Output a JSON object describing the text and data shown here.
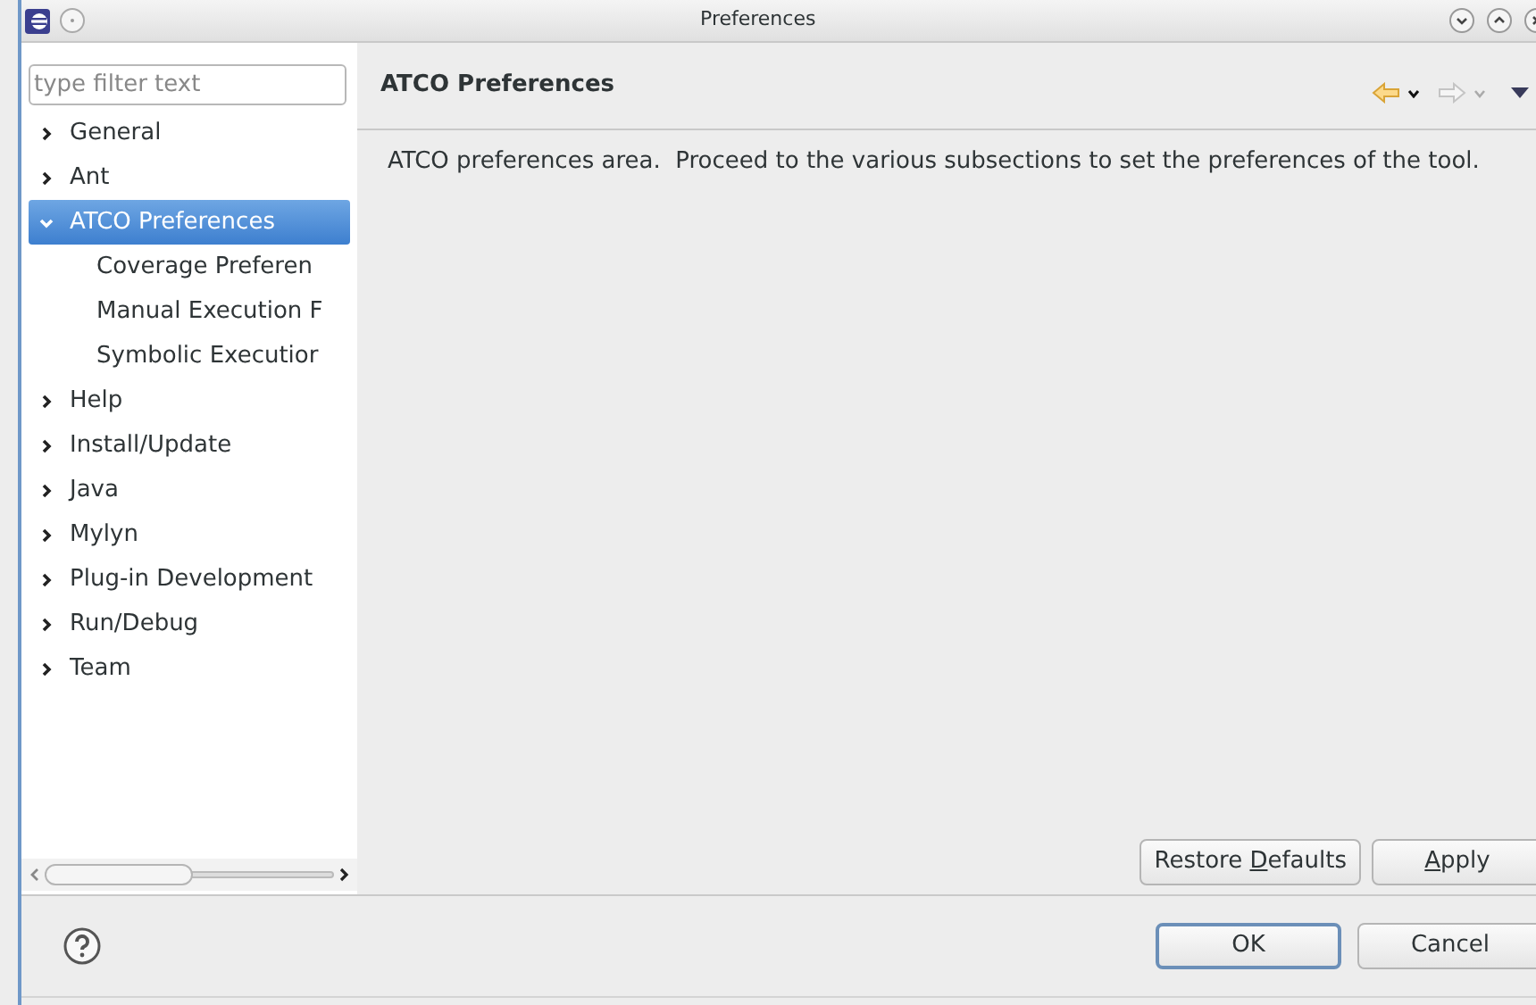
{
  "window": {
    "title": "Preferences"
  },
  "filter": {
    "placeholder": "type filter text"
  },
  "tree": [
    {
      "label": "General",
      "expanded": false,
      "selected": false
    },
    {
      "label": "Ant",
      "expanded": false,
      "selected": false
    },
    {
      "label": "ATCO Preferences",
      "expanded": true,
      "selected": true,
      "children": [
        {
          "label": "Coverage Preferen",
          "selected": false
        },
        {
          "label": "Manual Execution F",
          "selected": false
        },
        {
          "label": "Symbolic Executior",
          "selected": false
        }
      ]
    },
    {
      "label": "Help",
      "expanded": false,
      "selected": false
    },
    {
      "label": "Install/Update",
      "expanded": false,
      "selected": false
    },
    {
      "label": "Java",
      "expanded": false,
      "selected": false
    },
    {
      "label": "Mylyn",
      "expanded": false,
      "selected": false
    },
    {
      "label": "Plug-in Development",
      "expanded": false,
      "selected": false
    },
    {
      "label": "Run/Debug",
      "expanded": false,
      "selected": false
    },
    {
      "label": "Team",
      "expanded": false,
      "selected": false
    }
  ],
  "page": {
    "title": "ATCO Preferences",
    "description": "ATCO preferences area.  Proceed to the various subsections to set the preferences of the tool."
  },
  "page_buttons": [
    {
      "before": "Restore ",
      "key": "D",
      "after": "efaults"
    },
    {
      "key": "A",
      "after": "pply"
    }
  ],
  "dialog_buttons": [
    {
      "label": "OK",
      "default": true
    },
    {
      "label": "Cancel",
      "default": false
    }
  ]
}
